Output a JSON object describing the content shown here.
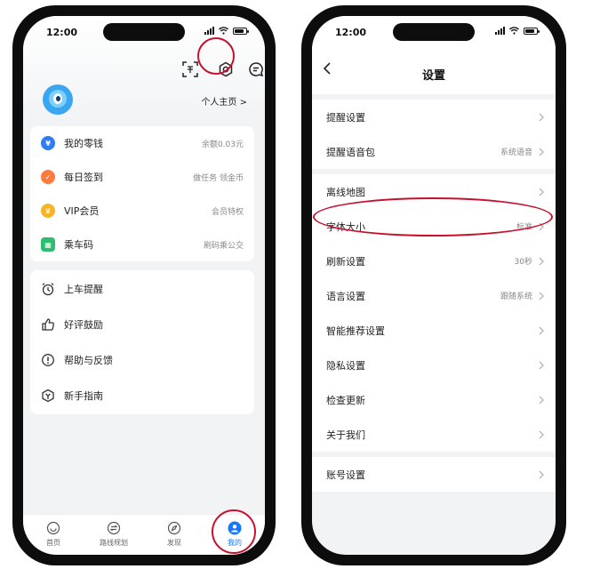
{
  "status": {
    "time": "12:00"
  },
  "left": {
    "profile_link": "个人主页 >",
    "group1": [
      {
        "label": "我的零钱",
        "value": "余额0.03元",
        "icon": "wallet-icon",
        "color": "#2f7cf6"
      },
      {
        "label": "每日签到",
        "value": "做任务 领金币",
        "icon": "checkin-icon",
        "color": "#ff7a3d"
      },
      {
        "label": "VIP会员",
        "value": "会员特权",
        "icon": "vip-crown-icon",
        "color": "#f7b425"
      },
      {
        "label": "乘车码",
        "value": "刷码乘公交",
        "icon": "bus-code-icon",
        "color": "#2ebc6e"
      }
    ],
    "group2": [
      {
        "label": "上车提醒",
        "icon": "alarm-clock-icon"
      },
      {
        "label": "好评鼓励",
        "icon": "thumbs-up-icon"
      },
      {
        "label": "帮助与反馈",
        "icon": "help-icon"
      },
      {
        "label": "新手指南",
        "icon": "guide-icon"
      }
    ],
    "tabs": [
      {
        "label": "首页",
        "icon": "home-smile-icon"
      },
      {
        "label": "路线规划",
        "icon": "route-icon"
      },
      {
        "label": "发现",
        "icon": "compass-icon"
      },
      {
        "label": "我的",
        "icon": "user-icon"
      }
    ],
    "active_tab": "我的"
  },
  "right": {
    "title": "设置",
    "groups": [
      [
        {
          "label": "提醒设置",
          "value": ""
        },
        {
          "label": "提醒语音包",
          "value": "系统语音"
        }
      ],
      [
        {
          "label": "离线地图",
          "value": ""
        },
        {
          "label": "字体大小",
          "value": "标准"
        },
        {
          "label": "刷新设置",
          "value": "30秒"
        },
        {
          "label": "语言设置",
          "value": "跟随系统"
        },
        {
          "label": "智能推荐设置",
          "value": ""
        },
        {
          "label": "隐私设置",
          "value": ""
        },
        {
          "label": "检查更新",
          "value": ""
        },
        {
          "label": "关于我们",
          "value": ""
        }
      ],
      [
        {
          "label": "账号设置",
          "value": ""
        }
      ]
    ]
  },
  "colors": {
    "accent": "#1677ff",
    "highlight": "#c8102e"
  }
}
